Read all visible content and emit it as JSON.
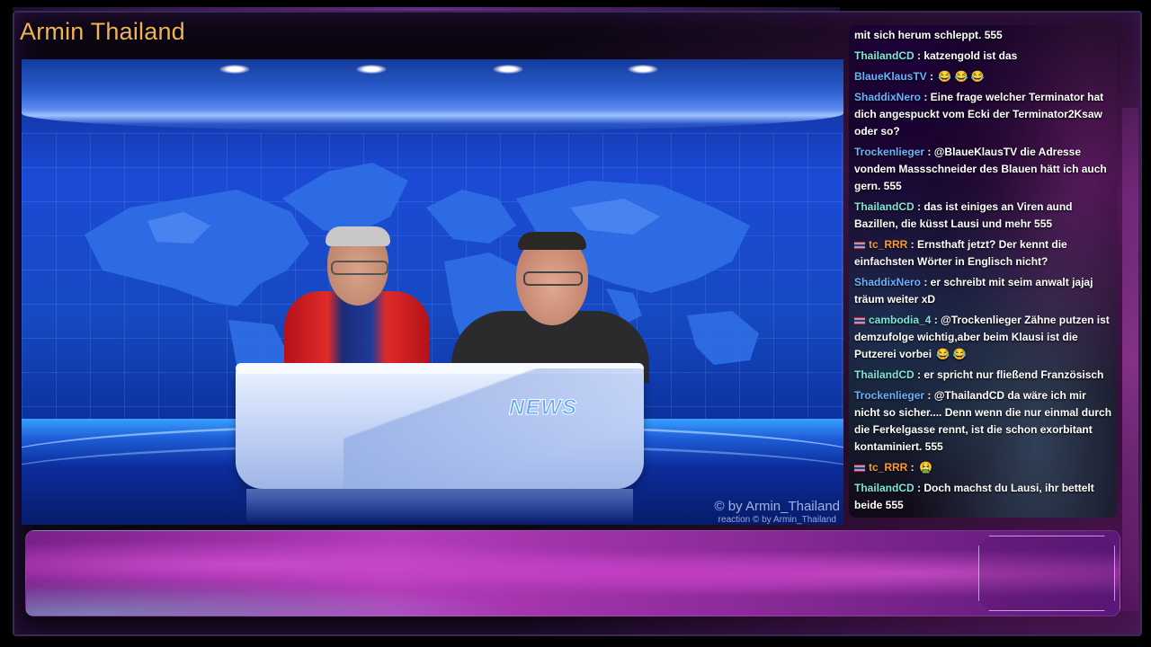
{
  "channel": {
    "title": "Armin Thailand"
  },
  "video": {
    "desk_logo": "NEWS",
    "watermark": "© by Armin_Thailand",
    "watermark_sub": "reaction  © by Armin_Thailand"
  },
  "colors": {
    "title": "#f2b257",
    "user_teal": "#7fe7d7",
    "user_blue": "#6ab3ff",
    "user_orange": "#ff9a2e",
    "studio_blue": "#1c4ad6",
    "banner_magenta": "#b43cba"
  },
  "chat": {
    "messages": [
      {
        "user": "",
        "text": "mit sich herum schleppt. 555",
        "user_color": "#ffffff",
        "flag": false
      },
      {
        "user": "ThailandCD",
        "text": " : katzengold ist das",
        "user_color": "#7fe7d7",
        "flag": false
      },
      {
        "user": "BlaueKlausTV",
        "text": " : ",
        "user_color": "#6ab3ff",
        "flag": false,
        "emoji": "😂 😂 😂"
      },
      {
        "user": "ShaddixNero",
        "text": " : Eine frage welcher Terminator hat dich angespuckt vom Ecki der Terminator2Ksaw oder so?",
        "user_color": "#6ab3ff",
        "flag": false
      },
      {
        "user": "Trockenlieger",
        "text": " : @BlaueKlausTV die Adresse vondem Massschneider des Blauen hätt ich auch gern. 555",
        "user_color": "#6ab3ff",
        "flag": false
      },
      {
        "user": "ThailandCD",
        "text": " : das ist einiges an Viren aund Bazillen, die küsst Lausi und mehr 555",
        "user_color": "#7fe7d7",
        "flag": false
      },
      {
        "user": "tc_RRR",
        "text": " : Ernsthaft jetzt? Der kennt die einfachsten Wörter in Englisch nicht?",
        "user_color": "#ff9a2e",
        "flag": true
      },
      {
        "user": "ShaddixNero",
        "text": " : er schreibt mit seim anwalt jajaj träum weiter xD",
        "user_color": "#6ab3ff",
        "flag": false
      },
      {
        "user": "cambodia_4",
        "text": " : @Trockenlieger Zähne putzen ist demzufolge wichtig,aber beim Klausi ist die Putzerei vorbei ",
        "user_color": "#7fe7d7",
        "flag": true,
        "emoji": "😂 😂"
      },
      {
        "user": "ThailandCD",
        "text": " : er spricht nur fließend Französisch",
        "user_color": "#7fe7d7",
        "flag": false
      },
      {
        "user": "Trockenlieger",
        "text": " : @ThailandCD da wäre ich mir nicht so sicher.... Denn wenn die nur einmal durch die Ferkelgasse rennt, ist die schon exorbitant kontaminiert. 555",
        "user_color": "#6ab3ff",
        "flag": false
      },
      {
        "user": "tc_RRR",
        "text": " : ",
        "user_color": "#ff9a2e",
        "flag": true,
        "emoji": "🤮"
      },
      {
        "user": "ThailandCD",
        "text": " : Doch machst du Lausi, ihr bettelt beide 555",
        "user_color": "#7fe7d7",
        "flag": false
      }
    ]
  }
}
